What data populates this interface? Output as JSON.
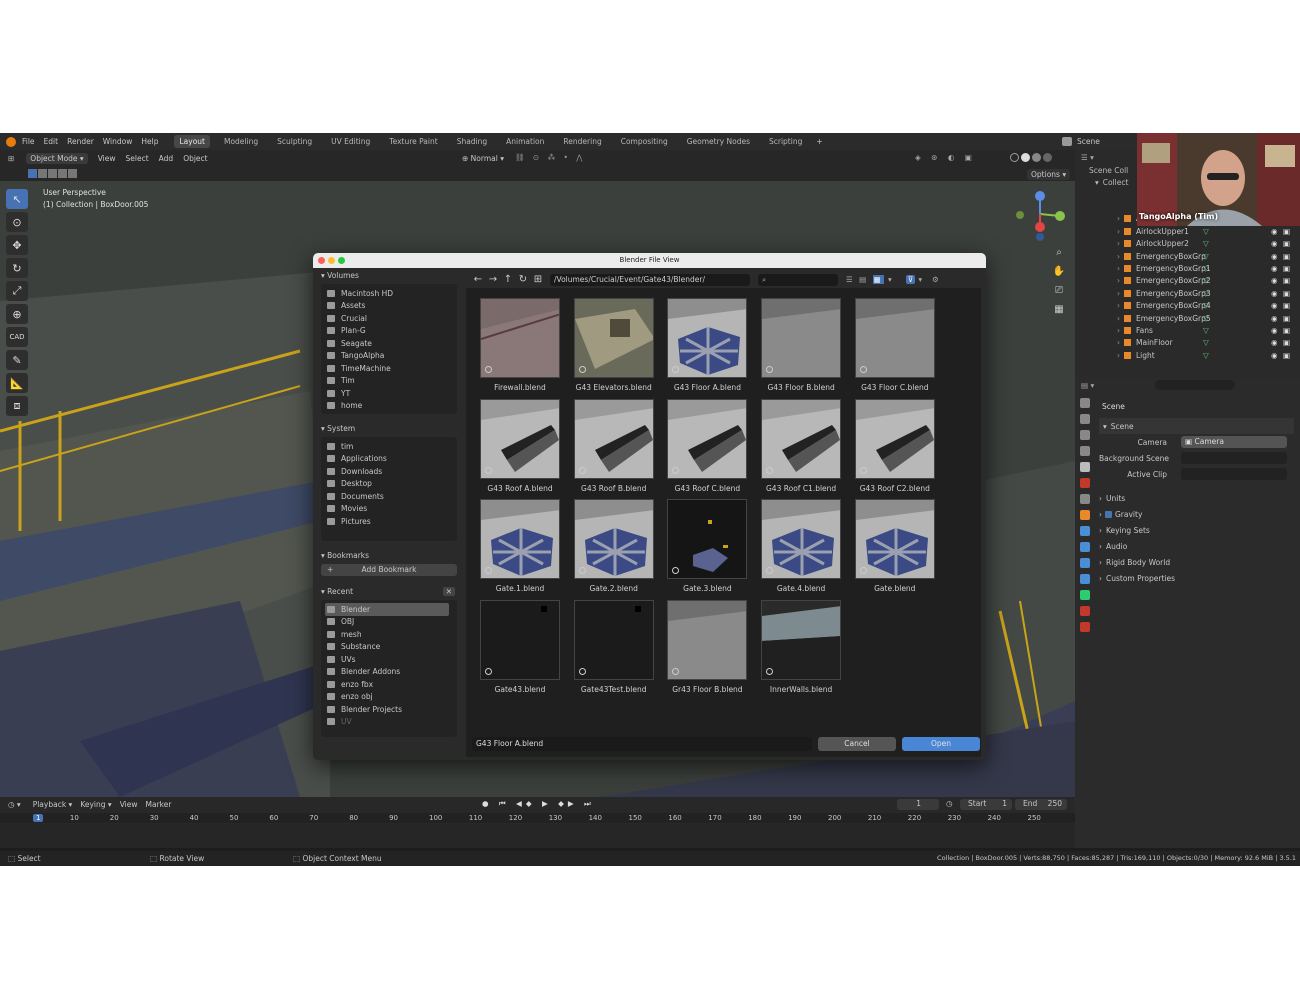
{
  "menubar": {
    "items": [
      "File",
      "Edit",
      "Render",
      "Window",
      "Help"
    ],
    "workspaces": [
      "Layout",
      "Modeling",
      "Sculpting",
      "UV Editing",
      "Texture Paint",
      "Shading",
      "Animation",
      "Rendering",
      "Compositing",
      "Geometry Nodes",
      "Scripting"
    ],
    "active_workspace": "Layout",
    "add_tab": "+",
    "scene_label": "Scene"
  },
  "viewport_header": {
    "mode": "Object Mode",
    "menus": [
      "View",
      "Select",
      "Add",
      "Object"
    ],
    "orientation": "Normal",
    "options": "Options"
  },
  "viewport": {
    "perspective": "User Perspective",
    "collection": "(1) Collection | BoxDoor.005"
  },
  "toolbar": {
    "cad_label": "CAD"
  },
  "webcam": {
    "name": "TangoAlpha (Tim)"
  },
  "outliner": {
    "header": "Scene Coll",
    "collection": "Collect",
    "items": [
      {
        "label": "AirlockLower2"
      },
      {
        "label": "AirlockUpper1"
      },
      {
        "label": "AirlockUpper2"
      },
      {
        "label": "EmergencyBoxGrp"
      },
      {
        "label": "EmergencyBoxGrp1"
      },
      {
        "label": "EmergencyBoxGrp2"
      },
      {
        "label": "EmergencyBoxGrp3"
      },
      {
        "label": "EmergencyBoxGrp4"
      },
      {
        "label": "EmergencyBoxGrp5"
      },
      {
        "label": "Fans"
      },
      {
        "label": "MainFloor"
      },
      {
        "label": "Light"
      }
    ]
  },
  "properties": {
    "title": "Scene",
    "panel": "Scene",
    "camera_label": "Camera",
    "camera_value": "Camera",
    "bg_scene_label": "Background Scene",
    "active_clip_label": "Active Clip",
    "sections": [
      "Units",
      "Gravity",
      "Keying Sets",
      "Audio",
      "Rigid Body World",
      "Custom Properties"
    ]
  },
  "dialog": {
    "title": "Blender File View",
    "path": "/Volumes/Crucial/Event/Gate43/Blender/",
    "search_placeholder": "",
    "volumes_title": "Volumes",
    "volumes": [
      "Macintosh HD",
      "Assets",
      "Crucial",
      "Plan-G",
      "Seagate",
      "TangoAlpha",
      "TimeMachine",
      "Tim",
      "YT",
      "home"
    ],
    "system_title": "System",
    "system": [
      "tim",
      "Applications",
      "Downloads",
      "Desktop",
      "Documents",
      "Movies",
      "Pictures"
    ],
    "bookmarks_title": "Bookmarks",
    "add_bookmark": "Add Bookmark",
    "recent_title": "Recent",
    "recent": [
      "Blender",
      "OBJ",
      "mesh",
      "Substance",
      "UVs",
      "Blender Addons",
      "enzo fbx",
      "enzo obj",
      "Blender Projects",
      "UV"
    ],
    "files": [
      {
        "name": "Firewall.blend",
        "kind": "wall"
      },
      {
        "name": "G43 Elevators.blend",
        "kind": "elev"
      },
      {
        "name": "G43 Floor A.blend",
        "kind": "hex"
      },
      {
        "name": "G43 Floor B.blend",
        "kind": "plain"
      },
      {
        "name": "G43 Floor C.blend",
        "kind": "plain"
      },
      {
        "name": "G43 Roof A.blend",
        "kind": "roof"
      },
      {
        "name": "G43 Roof B.blend",
        "kind": "roof"
      },
      {
        "name": "G43 Roof C.blend",
        "kind": "roof"
      },
      {
        "name": "G43 Roof C1.blend",
        "kind": "roof"
      },
      {
        "name": "G43 Roof C2.blend",
        "kind": "roof"
      },
      {
        "name": "Gate.1.blend",
        "kind": "hex"
      },
      {
        "name": "Gate.2.blend",
        "kind": "hex"
      },
      {
        "name": "Gate.3.blend",
        "kind": "dark"
      },
      {
        "name": "Gate.4.blend",
        "kind": "hex"
      },
      {
        "name": "Gate.blend",
        "kind": "hex"
      },
      {
        "name": "Gate43.blend",
        "kind": "black"
      },
      {
        "name": "Gate43Test.blend",
        "kind": "black"
      },
      {
        "name": "Gr43 Floor B.blend",
        "kind": "plain"
      },
      {
        "name": "InnerWalls.blend",
        "kind": "walls"
      }
    ],
    "filename": "G43 Floor A.blend",
    "cancel": "Cancel",
    "open": "Open"
  },
  "timeline": {
    "menus": [
      "Playback",
      "Keying",
      "View",
      "Marker"
    ],
    "current_frame": "1",
    "start_label": "Start",
    "start": "1",
    "end_label": "End",
    "end": "250",
    "ticks": [
      "1",
      "10",
      "20",
      "30",
      "40",
      "50",
      "60",
      "70",
      "80",
      "90",
      "100",
      "110",
      "120",
      "130",
      "140",
      "150",
      "160",
      "170",
      "180",
      "190",
      "200",
      "210",
      "220",
      "230",
      "240",
      "250"
    ]
  },
  "statusbar": {
    "select": "Select",
    "rotate": "Rotate View",
    "context": "Object Context Menu",
    "stats": "Collection | BoxDoor.005 | Verts:88,750 | Faces:85,287 | Tris:169,110 | Objects:0/30 | Memory: 92.6 MiB | 3.5.1"
  },
  "colors": {
    "accent": "#4772b3",
    "open_button": "#4a86d6",
    "cancel_button": "#555555"
  }
}
